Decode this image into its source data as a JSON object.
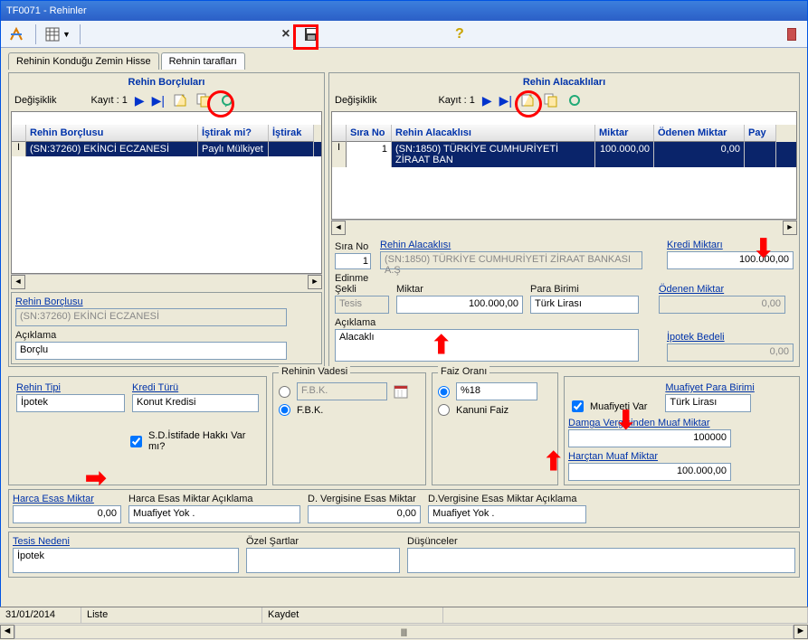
{
  "window": {
    "title": "TF0071 - Rehinler"
  },
  "tabs": {
    "hisse": "Rehinin Konduğu Zemin Hisse",
    "taraflar": "Rehnin tarafları"
  },
  "borclular": {
    "title": "Rehin Borçluları",
    "degisiklik": "Değişiklik",
    "kayit_label": "Kayıt : 1",
    "cols": {
      "borclu": "Rehin Borçlusu",
      "istirak": "İştirak mi?",
      "istirak2": "İştirak"
    },
    "row": {
      "borclu": "(SN:37260) EKİNCİ ECZANESİ",
      "istirak": "Paylı Mülkiyet"
    },
    "detail": {
      "borclu_label": "Rehin Borçlusu",
      "borclu_value": "(SN:37260) EKİNCİ ECZANESİ",
      "aciklama_label": "Açıklama",
      "aciklama_value": "Borçlu"
    }
  },
  "alacaklilar": {
    "title": "Rehin Alacaklıları",
    "degisiklik": "Değişiklik",
    "kayit_label": "Kayıt : 1",
    "cols": {
      "sira": "Sıra No",
      "alacakli": "Rehin Alacaklısı",
      "miktar": "Miktar",
      "odenen": "Ödenen Miktar",
      "pay": "Pay"
    },
    "row": {
      "sira": "1",
      "alacakli": "(SN:1850) TÜRKİYE CUMHURİYETİ ZİRAAT BAN",
      "miktar": "100.000,00",
      "odenen": "0,00"
    },
    "detail": {
      "sira_label": "Sıra No",
      "sira_value": "1",
      "alacakli_label": "Rehin Alacaklısı",
      "alacakli_value": "(SN:1850) TÜRKİYE CUMHURİYETİ ZİRAAT BANKASI A.Ş",
      "edinme_label": "Edinme Şekli",
      "edinme_value": "Tesis",
      "miktar_label": "Miktar",
      "miktar_value": "100.000,00",
      "para_label": "Para Birimi",
      "para_value": "Türk Lirası",
      "aciklama_label": "Açıklama",
      "aciklama_value": "Alacaklı",
      "kredi_label": "Kredi Miktarı",
      "kredi_value": "100.000,00",
      "odenen_label": "Ödenen Miktar",
      "odenen_value": "0,00",
      "ipotek_label": "İpotek Bedeli",
      "ipotek_value": "0,00"
    }
  },
  "bottom": {
    "rehin_tipi_label": "Rehin Tipi",
    "rehin_tipi_value": "İpotek",
    "kredi_turu_label": "Kredi Türü",
    "kredi_turu_value": "Konut Kredisi",
    "sd_label": "S.D.İstifade Hakkı Var mı?",
    "vade_title": "Rehinin Vadesi",
    "vade_fbk1": "F.B.K.",
    "vade_fbk2": "F.B.K.",
    "faiz_title": "Faiz Oranı",
    "faiz_18": "%18",
    "faiz_kanuni": "Kanuni Faiz",
    "muafiyeti_var": "Muafiyeti Var",
    "muaf_para_label": "Muafiyet Para Birimi",
    "muaf_para_value": "Türk Lirası",
    "damga_label": "Damga Vergisinden Muaf Miktar",
    "damga_value": "100000",
    "harctan_label": "Harçtan Muaf Miktar",
    "harctan_value": "100.000,00",
    "harca_label": "Harca Esas Miktar",
    "harca_value": "0,00",
    "harca_acik_label": "Harca Esas Miktar Açıklama",
    "harca_acik_value": "Muafiyet Yok .",
    "dverg_label": "D. Vergisine Esas Miktar",
    "dverg_value": "0,00",
    "dverg_acik_label": "D.Vergisine Esas Miktar Açıklama",
    "dverg_acik_value": "Muafiyet Yok .",
    "tesis_label": "Tesis Nedeni",
    "tesis_value": "İpotek",
    "ozel_label": "Özel Şartlar",
    "dusunce_label": "Düşünceler"
  },
  "status": {
    "date": "31/01/2014",
    "liste": "Liste",
    "kaydet": "Kaydet"
  }
}
